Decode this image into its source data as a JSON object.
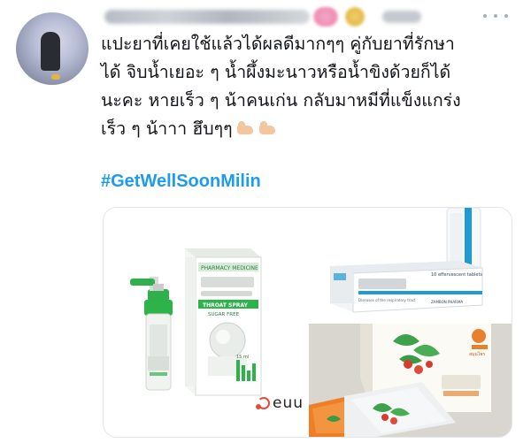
{
  "tweet": {
    "text_lines": [
      "แปะยาที่เคยใช้แล้วได้ผลดีมากๆๆ คู่กับยาที่รักษา",
      "ได้ จิบน้ำเยอะ ๆ น้ำผึ้งมะนาวหรือน้ำขิงด้วยก็ได้",
      "นะคะ หายเร็ว ๆ น้าคนเก่น กลับมาหมีที่แข็งแกร่ง",
      "เร็ว ๆ น้าาา ฮึบๆๆ"
    ],
    "emoji_icons": [
      "flexed-biceps-icon",
      "flexed-biceps-icon"
    ],
    "hashtag": "#GetWellSoonMilin"
  },
  "media": {
    "watermark": "euu",
    "images": [
      {
        "name": "throat-spray-product-image",
        "box_label": "PHARMACY MEDICINE",
        "box_sub": "THROAT SPRAY",
        "product_sub": "SUGAR FREE",
        "volume": "15 ml"
      },
      {
        "name": "effervescent-tablet-product-image",
        "box_label": "10 effervescent tablets",
        "box_note": "Diseases of the respiratory tract",
        "maker": "ZAMBON PHARMA"
      },
      {
        "name": "herbal-sachet-product-image",
        "brand": "สมุนไพร"
      }
    ]
  },
  "colors": {
    "hashtag": "#1d9bf0",
    "text": "#0f1419",
    "muted": "#a7b0ba",
    "accent_green": "#2db34a",
    "accent_blue": "#1e9ad6",
    "accent_orange": "#e8812b"
  }
}
